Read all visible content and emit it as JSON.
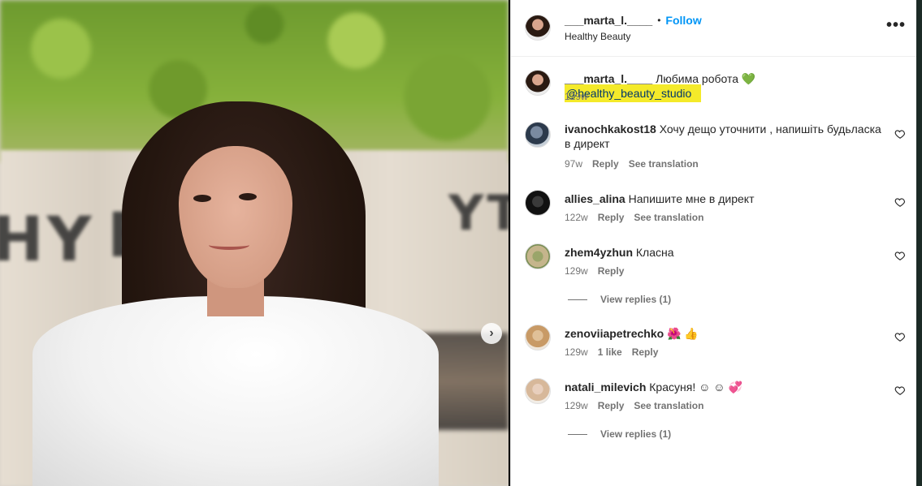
{
  "post": {
    "header": {
      "username": "___marta_l.____",
      "separator": "•",
      "follow_label": "Follow",
      "location": "Healthy Beauty",
      "more_icon": "more-horizontal-icon",
      "more_glyph": "•••"
    },
    "photo": {
      "wall_text_left": "HY",
      "wall_text_mid": "BE",
      "wall_text_right": "Y",
      "wall_text_far": "YT",
      "next_glyph": "›"
    },
    "caption": {
      "username": "___marta_l.____",
      "text": "Любима робота",
      "emoji": "💚",
      "mention": "@healthy_beauty_studio",
      "time": "129w"
    },
    "comments": [
      {
        "username": "ivanochkakost18",
        "text": "Хочу дещо уточнити , напишіть будьласка в директ",
        "time": "97w",
        "likes": "",
        "reply_label": "Reply",
        "translation_label": "See translation",
        "view_replies": ""
      },
      {
        "username": "allies_alina",
        "text": "Напишите мне в директ",
        "time": "122w",
        "likes": "",
        "reply_label": "Reply",
        "translation_label": "See translation",
        "view_replies": ""
      },
      {
        "username": "zhem4yzhun",
        "text": "Класна",
        "time": "129w",
        "likes": "",
        "reply_label": "Reply",
        "translation_label": "",
        "view_replies": "View replies (1)"
      },
      {
        "username": "zenoviiapetrechko",
        "text": "🌺 👍",
        "time": "129w",
        "likes": "1 like",
        "reply_label": "Reply",
        "translation_label": "",
        "view_replies": ""
      },
      {
        "username": "natali_milevich",
        "text": "Красуня! ☺ ☺ 💞",
        "time": "129w",
        "likes": "",
        "reply_label": "Reply",
        "translation_label": "See translation",
        "view_replies": "View replies (1)"
      }
    ]
  },
  "colors": {
    "follow": "#0095f6",
    "highlight": "#f4ea2a",
    "meta": "#737373"
  }
}
